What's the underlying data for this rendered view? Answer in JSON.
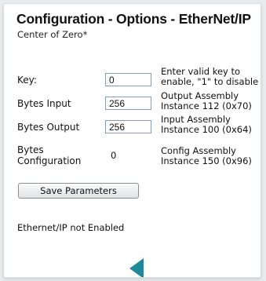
{
  "header": {
    "title": "Configuration - Options - EtherNet/IP",
    "subtitle": "Center of Zero*"
  },
  "form": {
    "key": {
      "label": "Key:",
      "value": "0",
      "description": "Enter valid key to enable, \"1\" to disable"
    },
    "bytes_input": {
      "label": "Bytes Input",
      "value": "256",
      "description": "Output Assembly Instance 112 (0x70)"
    },
    "bytes_output": {
      "label": "Bytes Output",
      "value": "256",
      "description": "Input Assembly Instance 100 (0x64)"
    },
    "bytes_configuration": {
      "label": "Bytes Configuration",
      "value": "0",
      "description": "Config Assembly Instance 150 (0x96)"
    }
  },
  "actions": {
    "save_label": "Save Parameters"
  },
  "status": {
    "text": "Ethernet/IP not Enabled"
  },
  "navigation": {
    "back_icon": "left-triangle-arrow",
    "back_color": "#1f8a99"
  }
}
